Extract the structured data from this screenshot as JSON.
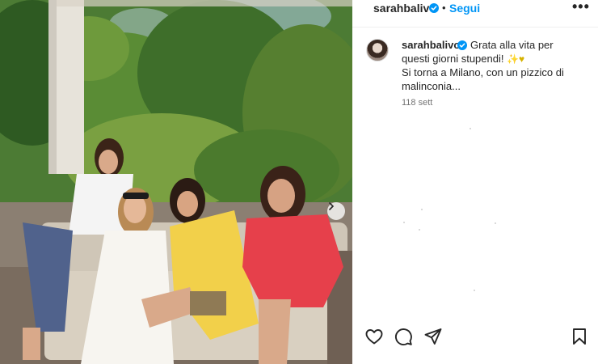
{
  "post": {
    "username": "sarahbalivo",
    "separator": "•",
    "follow_label": "Segui",
    "more_label": "•••"
  },
  "caption": {
    "username": "sarahbalivo",
    "line1": "Grata alla vita per",
    "line2_text": "questi giorni stupendi!",
    "line2_emoji": "✨♥",
    "line3": "Si torna a Milano, con un pizzico di",
    "line4": "malinconia...",
    "time": "118 sett"
  },
  "icons": {
    "verified": "verified-badge-icon",
    "more": "more-options-icon",
    "next": "chevron-right-icon",
    "like": "heart-icon",
    "comment": "comment-icon",
    "share": "paper-plane-icon",
    "save": "bookmark-icon"
  },
  "colors": {
    "accent": "#0095f6",
    "text": "#262626",
    "muted": "#737373"
  }
}
